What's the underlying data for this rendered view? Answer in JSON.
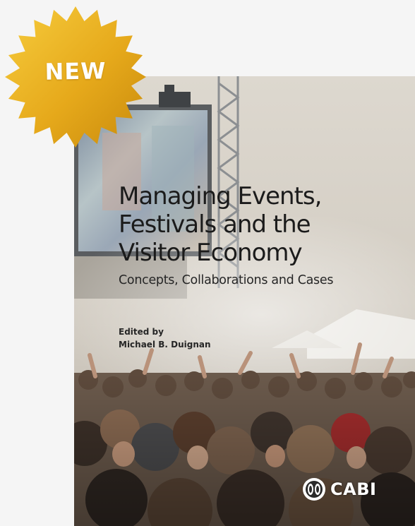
{
  "badge": {
    "label": "NEW",
    "color_light": "#f3c233",
    "color_dark": "#c88a0c"
  },
  "book": {
    "title_lines": [
      "Managing Events,",
      "Festivals and the",
      "Visitor Economy"
    ],
    "subtitle": "Concepts, Collaborations and Cases",
    "edited_label": "Edited by",
    "author": "Michael B. Duignan",
    "publisher": "CABI"
  },
  "icons": {
    "badge": "starburst-badge",
    "publisher_logo": "cabi-logo"
  }
}
